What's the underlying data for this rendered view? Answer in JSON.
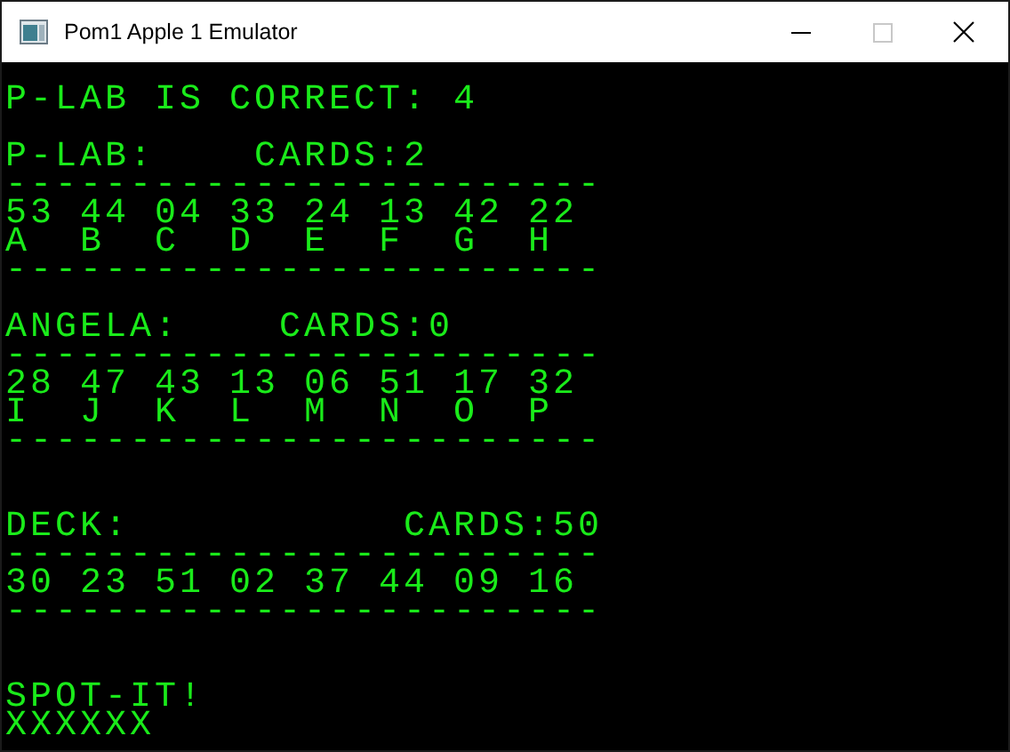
{
  "window": {
    "title": "Pom1 Apple 1 Emulator"
  },
  "screen": {
    "lines": [
      {
        "kind": "text",
        "text": "P-LAB IS CORRECT: 4"
      },
      {
        "kind": "blank"
      },
      {
        "kind": "text",
        "text": "P-LAB:    CARDS:2"
      },
      {
        "kind": "text",
        "text": "------------------------"
      },
      {
        "kind": "text",
        "text": "53 44 04 33 24 13 42 22"
      },
      {
        "kind": "text",
        "text": "A  B  C  D  E  F  G  H"
      },
      {
        "kind": "text",
        "text": "------------------------"
      },
      {
        "kind": "blank"
      },
      {
        "kind": "text",
        "text": "ANGELA:    CARDS:0"
      },
      {
        "kind": "text",
        "text": "------------------------"
      },
      {
        "kind": "text",
        "text": "28 47 43 13 06 51 17 32"
      },
      {
        "kind": "text",
        "text": "I  J  K  L  M  N  O  P"
      },
      {
        "kind": "text",
        "text": "------------------------"
      },
      {
        "kind": "blank"
      },
      {
        "kind": "blank"
      },
      {
        "kind": "text",
        "text": "DECK:           CARDS:50"
      },
      {
        "kind": "text",
        "text": "------------------------"
      },
      {
        "kind": "text",
        "text": "30 23 51 02 37 44 09 16"
      },
      {
        "kind": "text",
        "text": "------------------------"
      },
      {
        "kind": "blank"
      },
      {
        "kind": "blank"
      },
      {
        "kind": "text",
        "text": "SPOT-IT!"
      },
      {
        "kind": "text",
        "text": "XXXXXX"
      }
    ]
  }
}
